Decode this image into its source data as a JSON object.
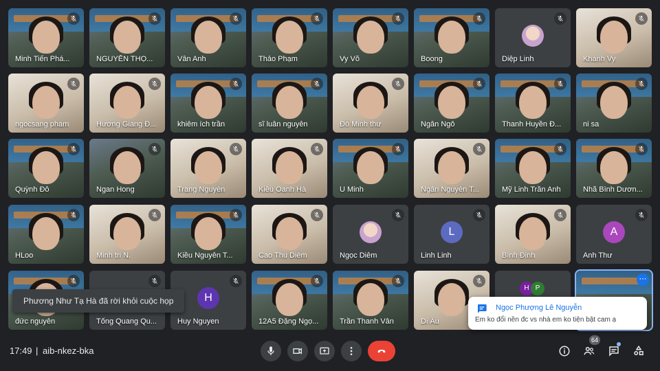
{
  "participants": [
    {
      "name": "Minh Tiến Phá...",
      "kind": "video-banner"
    },
    {
      "name": "NGUYỄN THỌ...",
      "kind": "video-banner"
    },
    {
      "name": "Vân Anh",
      "kind": "video-banner"
    },
    {
      "name": "Thảo Phạm",
      "kind": "video-banner"
    },
    {
      "name": "Vy Võ",
      "kind": "video-banner"
    },
    {
      "name": "Boong",
      "kind": "video-banner"
    },
    {
      "name": "Diệp Linh",
      "kind": "photo-avatar"
    },
    {
      "name": "Khánh Vy",
      "kind": "video-light"
    },
    {
      "name": "ngocsang pham",
      "kind": "video-light"
    },
    {
      "name": "Hương Giang Đ...",
      "kind": "video-light"
    },
    {
      "name": "khiêm ích trần",
      "kind": "video-banner"
    },
    {
      "name": "sĩ luân nguyễn",
      "kind": "video-banner"
    },
    {
      "name": "Đỗ Minh thư",
      "kind": "video-light"
    },
    {
      "name": "Ngân Ngô",
      "kind": "video-banner"
    },
    {
      "name": "Thanh Huyền Đ...",
      "kind": "video-banner"
    },
    {
      "name": "ni sa",
      "kind": "video-banner"
    },
    {
      "name": "Quỳnh Đỗ",
      "kind": "video-banner"
    },
    {
      "name": "Ngan Hong",
      "kind": "video"
    },
    {
      "name": "Trang Nguyễn",
      "kind": "video-light"
    },
    {
      "name": "Kiều Oanh Hà",
      "kind": "video-light"
    },
    {
      "name": "U Minh",
      "kind": "video-banner"
    },
    {
      "name": "Ngân Nguyễn T...",
      "kind": "video-light"
    },
    {
      "name": "Mỹ Linh Trần Anh",
      "kind": "video-banner"
    },
    {
      "name": "Nhã Bình Dươn...",
      "kind": "video-banner"
    },
    {
      "name": "HLoo",
      "kind": "video-banner"
    },
    {
      "name": "Minh tri N.",
      "kind": "video-light"
    },
    {
      "name": "Kiều Nguyễn T...",
      "kind": "video-banner"
    },
    {
      "name": "Cao Thu Diễm",
      "kind": "video-light"
    },
    {
      "name": "Ngọc Diễm",
      "kind": "photo-avatar"
    },
    {
      "name": "Linh Linh",
      "kind": "letter",
      "letter": "L",
      "color": "#5c6bc0"
    },
    {
      "name": "Bình Định",
      "kind": "video-light"
    },
    {
      "name": "Anh Thư",
      "kind": "letter",
      "letter": "A",
      "color": "#ab47bc"
    },
    {
      "name": "đức nguyễn",
      "kind": "video-banner"
    },
    {
      "name": "Tống Quang Qu...",
      "kind": "blank"
    },
    {
      "name": "Huy Nguyen",
      "kind": "letter",
      "letter": "H",
      "color": "#5e35b1"
    },
    {
      "name": "12A5 Đặng Ngọ...",
      "kind": "video-banner"
    },
    {
      "name": "Trần Thanh Vân",
      "kind": "video-banner"
    },
    {
      "name": "Di Âu",
      "kind": "video-light"
    },
    {
      "name": "",
      "kind": "multi",
      "letters": [
        "H",
        "P"
      ]
    },
    {
      "name": "",
      "kind": "self-selected"
    }
  ],
  "toast": "Phương Như Tạ Hà đã rời khỏi cuộc họp",
  "chat_popup": {
    "sender": "Ngọc Phượng Lê Nguyễn",
    "message": "Em ko đổi nền đc vs nhà em ko tiện bật cam ạ"
  },
  "bottom_bar": {
    "time": "17:49",
    "separator": "|",
    "meeting_code": "aib-nkez-bka",
    "participant_count": "64"
  },
  "colors": {
    "background": "#202124",
    "tile": "#3c4043",
    "hangup": "#ea4335",
    "accent": "#1a73e8"
  },
  "icons": [
    "mic-off-icon",
    "mic-icon",
    "camera-icon",
    "present-icon",
    "more-vert-icon",
    "hangup-icon",
    "info-icon",
    "people-icon",
    "chat-icon",
    "activities-icon"
  ]
}
